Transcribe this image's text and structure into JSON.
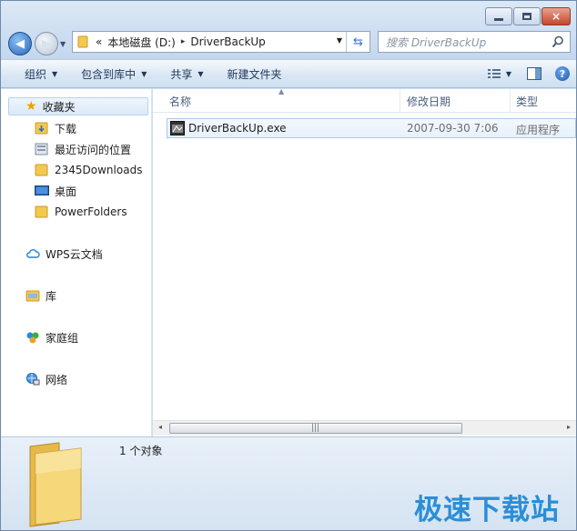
{
  "window": {
    "controls": {
      "minimize": "minimize",
      "maximize": "maximize",
      "close": "×"
    }
  },
  "address": {
    "prefix": "«",
    "crumbs": [
      "本地磁盘 (D:)",
      "DriverBackUp"
    ],
    "separator": "▸"
  },
  "search": {
    "placeholder": "搜索 DriverBackUp"
  },
  "toolbar": {
    "organize": "组织",
    "include_in_library": "包含到库中",
    "share": "共享",
    "new_folder": "新建文件夹"
  },
  "nav": {
    "favorites": "收藏夹",
    "items": [
      {
        "label": "下载",
        "icon": "download-folder-icon"
      },
      {
        "label": "最近访问的位置",
        "icon": "recent-places-icon"
      },
      {
        "label": "2345Downloads",
        "icon": "folder-icon"
      },
      {
        "label": "桌面",
        "icon": "desktop-icon"
      },
      {
        "label": "PowerFolders",
        "icon": "folder-icon"
      }
    ],
    "wps": "WPS云文档",
    "libraries": "库",
    "homegroup": "家庭组",
    "network": "网络"
  },
  "columns": {
    "name": "名称",
    "modified": "修改日期",
    "type": "类型"
  },
  "files": [
    {
      "name": "DriverBackUp.exe",
      "modified": "2007-09-30 7:06",
      "type": "应用程序"
    }
  ],
  "scrollbar": {
    "left_arrow": "◂",
    "right_arrow": "▸",
    "grip": "|||"
  },
  "details": {
    "count": "1 个对象"
  },
  "watermark": "极速下载站",
  "colors": {
    "accent": "#2b8ed6",
    "selection": "#dce9f8",
    "folder": "#f2c94c"
  }
}
